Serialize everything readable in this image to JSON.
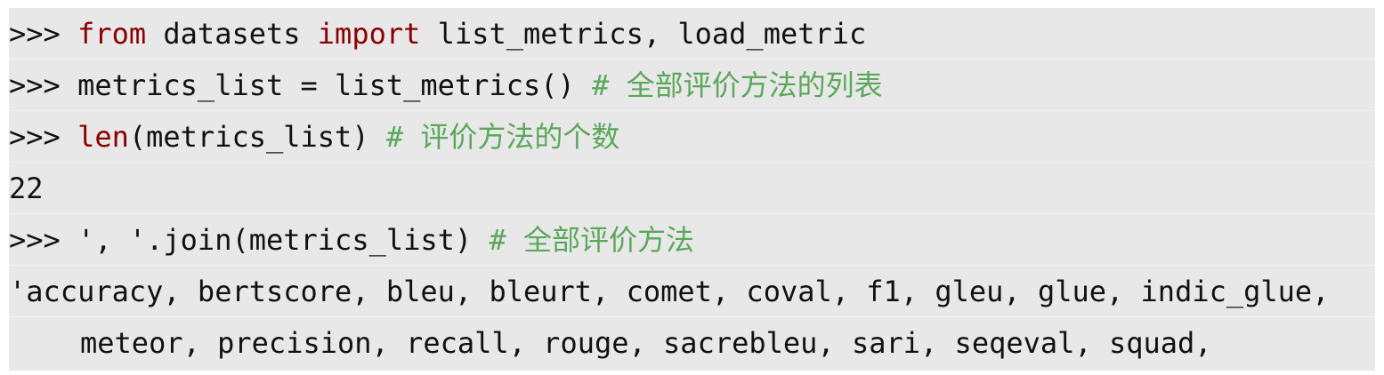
{
  "code": {
    "prompt": ">>> ",
    "line1": {
      "kw_from": "from",
      "module": " datasets ",
      "kw_import": "import",
      "names": " list_metrics, load_metric"
    },
    "line2": {
      "code": "metrics_list = list_metrics() ",
      "comment_hash": "# ",
      "comment_text": "全部评价方法的列表"
    },
    "line3": {
      "builtin": "len",
      "code": "(metrics_list) ",
      "comment_hash": "# ",
      "comment_text": "评价方法的个数"
    },
    "line4": {
      "output": "22"
    },
    "line5": {
      "code": "', '.join(metrics_list) ",
      "comment_hash": "# ",
      "comment_text": "全部评价方法"
    },
    "line6": {
      "output": "'accuracy, bertscore, bleu, bleurt, comet, coval, f1, gleu, glue, indic_glue,"
    },
    "line7": {
      "output": "meteor, precision, recall, rouge, sacrebleu, sari, seqeval, squad,"
    }
  },
  "colors": {
    "background": "#e8e8e8",
    "keyword": "#8b0000",
    "comment": "#5aa85a",
    "text": "#111111"
  }
}
